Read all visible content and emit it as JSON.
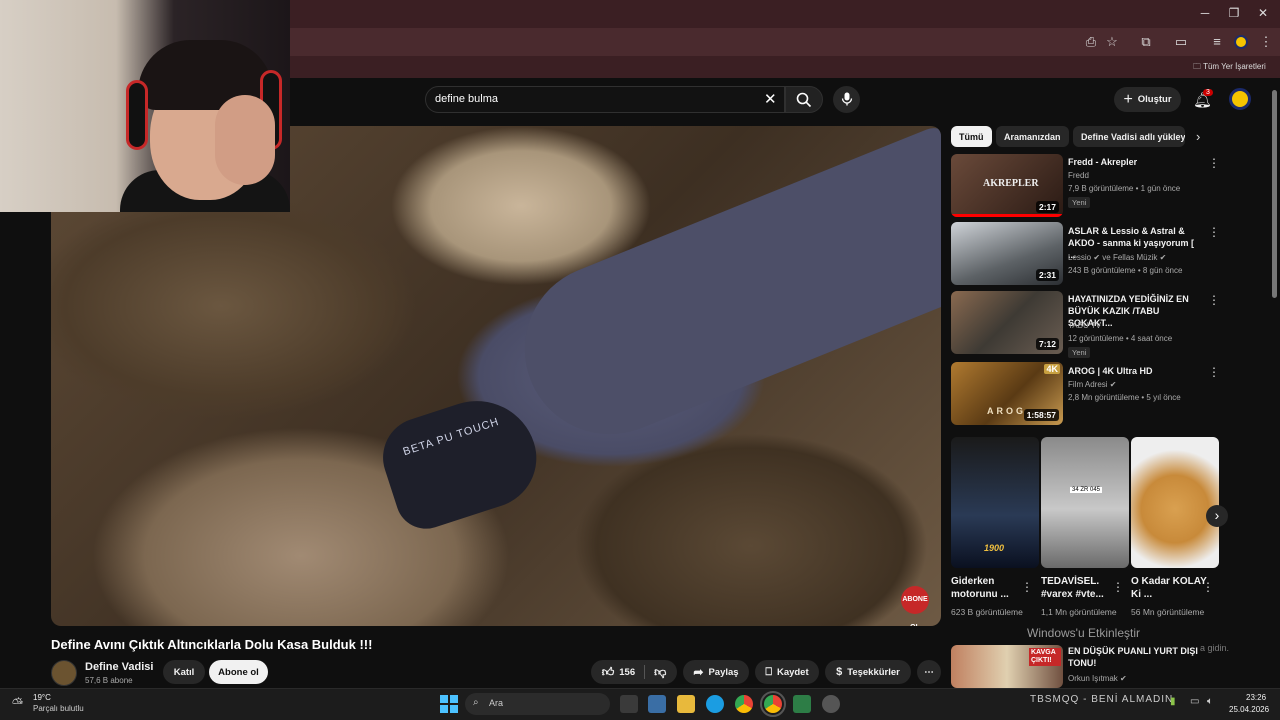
{
  "browser": {
    "bookmarks_label": "Tüm Yer İşaretleri"
  },
  "header": {
    "search_value": "define bulma",
    "create_label": "Oluştur",
    "notif_count": "3"
  },
  "video": {
    "glove_text": "BETA PU TOUCH",
    "subscribe_overlay": "ABONE OL"
  },
  "info": {
    "title": "Define Avını Çıktık Altıncıklarla Dolu Kasa Bulduk !!!",
    "channel": "Define Vadisi",
    "subs": "57,6 B abone",
    "join": "Katıl",
    "subscribe": "Abone ol",
    "likes": "156",
    "share": "Paylaş",
    "save": "Kaydet",
    "thanks": "Teşekkürler",
    "more": "⋯"
  },
  "chips": [
    "Tümü",
    "Aramanızdan",
    "Define Vadisi adlı yükleyen"
  ],
  "recs": [
    {
      "title": "Fredd - Akrepler",
      "channel": "Fredd",
      "meta": "7,9 B görüntüleme • 1 gün önce",
      "duration": "2:17",
      "badge": "Yeni",
      "thumb_text": "AKREPLER"
    },
    {
      "title": "ASLAR & Lessio & Astral & AKDO - sanma ki yaşıyorum [ ...",
      "channel": "Lessio ✔ ve Fellas Müzik ✔",
      "meta": "243 B görüntüleme • 8 gün önce",
      "duration": "2:31"
    },
    {
      "title": "HAYATINIZDA YEDİĞİNİZ EN BÜYÜK KAZIK /TABU SOKAKT...",
      "channel": "TABU TV",
      "meta": "12 görüntüleme • 4 saat önce",
      "duration": "7:12",
      "badge": "Yeni"
    },
    {
      "title": "AROG | 4K Ultra HD",
      "channel": "Film Adresi ✔",
      "meta": "2,8 Mn görüntüleme • 5 yıl önce",
      "duration": "1:58:57",
      "thumb_text": "AROG",
      "corner": "4K"
    }
  ],
  "shorts": [
    {
      "title": "Giderken motorunu ...",
      "views": "623 B görüntüleme",
      "overlay": "1900"
    },
    {
      "title": "TEDAVİSEL. #varex #vte...",
      "views": "1,1 Mn görüntüleme",
      "overlay": "34 ZR 045"
    },
    {
      "title": "O Kadar KOLAY Ki ...",
      "views": "56 Mn görüntüleme"
    }
  ],
  "rec5": {
    "title": "EN DÜŞÜK PUANLI YURT DIŞI TONU!",
    "channel": "Orkun Işıtmak ✔",
    "thumb_text": "KAVGA ÇIKTI!"
  },
  "overlay": {
    "activate": "Windows'u Etkinleştir",
    "activate_sub": "a gidin."
  },
  "taskbar": {
    "weather_temp": "19°C",
    "weather_desc": "Parçalı bulutlu",
    "search": "Ara",
    "media": "TBSMQQ - BENİ ALMADIN",
    "time": "23:26",
    "date": "25.04.2026"
  },
  "colors": {
    "accent": "#ff0000",
    "background": "#0f0f0f",
    "chip_active": "#f1f1f1"
  }
}
